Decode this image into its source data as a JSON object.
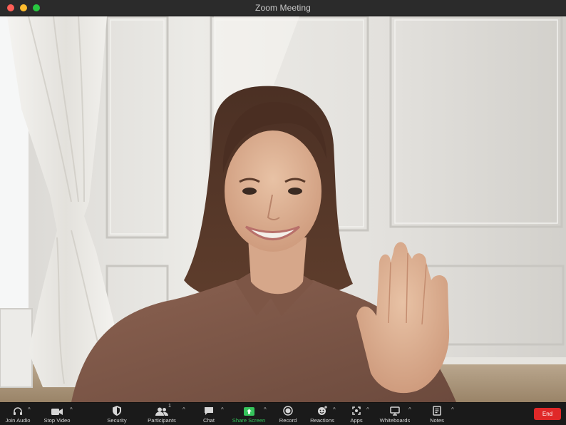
{
  "window": {
    "title": "Zoom Meeting"
  },
  "toolbar": {
    "join_audio": "Join Audio",
    "stop_video": "Stop Video",
    "security": "Security",
    "participants": "Participants",
    "participants_count": "1",
    "chat": "Chat",
    "share_screen": "Share Screen",
    "record": "Record",
    "reactions": "Reactions",
    "apps": "Apps",
    "whiteboards": "Whiteboards",
    "notes": "Notes",
    "end": "End"
  },
  "colors": {
    "share_accent": "#35c45b",
    "end_button": "#e02828",
    "toolbar_bg": "#1a1a1a"
  }
}
